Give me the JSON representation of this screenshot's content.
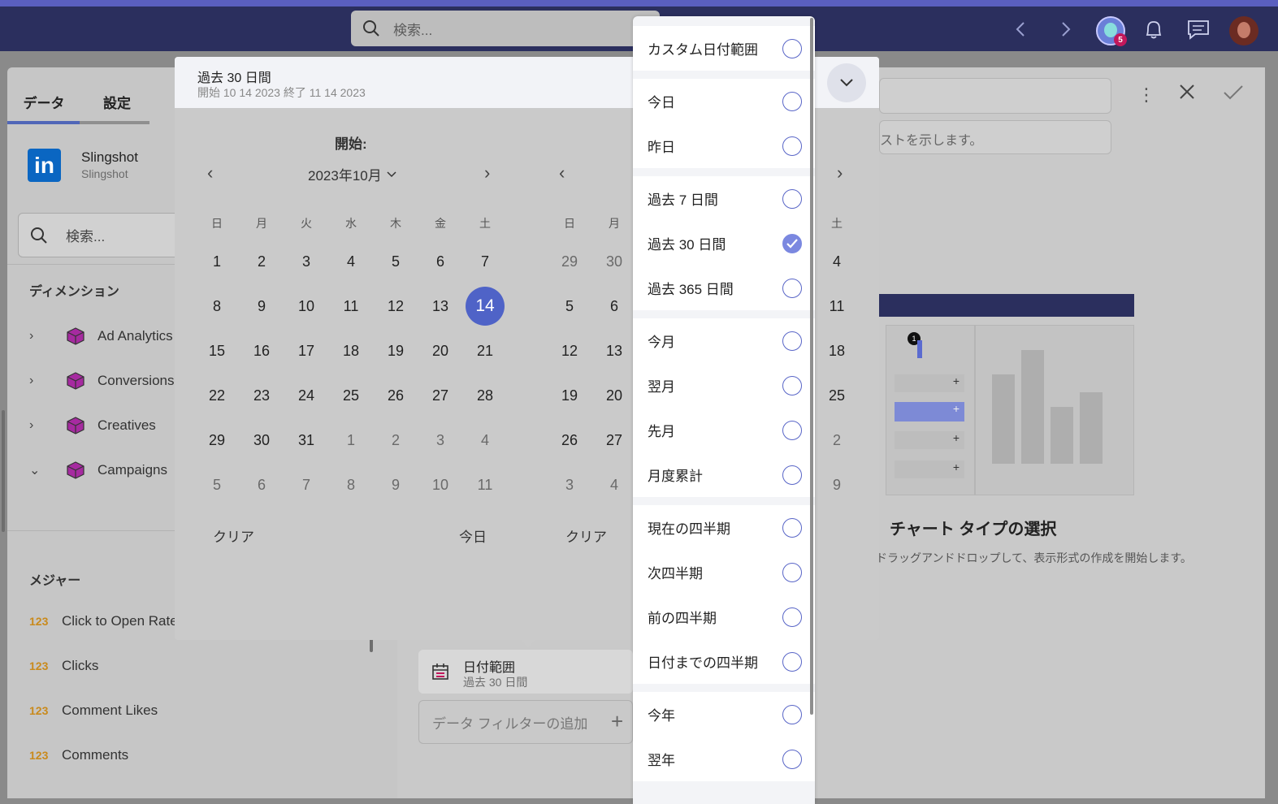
{
  "topbar": {
    "search_placeholder": "検索...",
    "notification_count": "5"
  },
  "left": {
    "tabs": [
      "データ",
      "設定"
    ],
    "datasource": {
      "name": "Slingshot",
      "sub": "Slingshot",
      "logo": "in"
    },
    "search_placeholder": "検索...",
    "dimensions_title": "ディメンション",
    "dimensions": [
      {
        "label": "Ad Analytics",
        "expanded": false
      },
      {
        "label": "Conversions",
        "expanded": false
      },
      {
        "label": "Creatives",
        "expanded": false
      },
      {
        "label": "Campaigns",
        "expanded": true
      }
    ],
    "measures_title": "メジャー",
    "measure_type": "123",
    "measures": [
      "Click to Open Rate",
      "Clicks",
      "Comment Likes",
      "Comments"
    ]
  },
  "right": {
    "hint_text": "ストを示します。",
    "chart_title": "チャート タイプの選択",
    "chart_sub": "ドラッグアンドドロップして、表示形式の作成を開始します。",
    "badge": "1"
  },
  "filter": {
    "title": "日付範囲",
    "sub": "過去 30 日間",
    "add_label": "データ フィルターの追加"
  },
  "picker": {
    "title": "過去 30 日間",
    "sub": "開始 10 14 2023 終了 11 14 2023",
    "start_label": "開始:",
    "month_label": "2023年10月",
    "weekdays": [
      "日",
      "月",
      "火",
      "水",
      "木",
      "金",
      "土"
    ],
    "clear_label": "クリア",
    "today_label": "今日",
    "selected_day": "14",
    "left_weeks": [
      [
        "1",
        "2",
        "3",
        "4",
        "5",
        "6",
        "7"
      ],
      [
        "8",
        "9",
        "10",
        "11",
        "12",
        "13",
        "14"
      ],
      [
        "15",
        "16",
        "17",
        "18",
        "19",
        "20",
        "21"
      ],
      [
        "22",
        "23",
        "24",
        "25",
        "26",
        "27",
        "28"
      ],
      [
        "29",
        "30",
        "31",
        "1",
        "2",
        "3",
        "4"
      ],
      [
        "5",
        "6",
        "7",
        "8",
        "9",
        "10",
        "11"
      ]
    ],
    "right_weeks_visible": [
      [
        "29",
        "30",
        "4"
      ],
      [
        "5",
        "6",
        "11"
      ],
      [
        "12",
        "13",
        "18"
      ],
      [
        "19",
        "20",
        "25"
      ],
      [
        "26",
        "27",
        "2"
      ],
      [
        "3",
        "4",
        "9"
      ]
    ]
  },
  "dropdown": {
    "groups": [
      [
        {
          "label": "カスタム日付範囲",
          "checked": false
        }
      ],
      [
        {
          "label": "今日",
          "checked": false
        },
        {
          "label": "昨日",
          "checked": false
        }
      ],
      [
        {
          "label": "過去 7 日間",
          "checked": false
        },
        {
          "label": "過去 30 日間",
          "checked": true
        },
        {
          "label": "過去 365 日間",
          "checked": false
        }
      ],
      [
        {
          "label": "今月",
          "checked": false
        },
        {
          "label": "翌月",
          "checked": false
        },
        {
          "label": "先月",
          "checked": false
        },
        {
          "label": "月度累計",
          "checked": false
        }
      ],
      [
        {
          "label": "現在の四半期",
          "checked": false
        },
        {
          "label": "次四半期",
          "checked": false
        },
        {
          "label": "前の四半期",
          "checked": false
        },
        {
          "label": "日付までの四半期",
          "checked": false
        }
      ],
      [
        {
          "label": "今年",
          "checked": false
        },
        {
          "label": "翌年",
          "checked": false
        }
      ]
    ]
  },
  "colors": {
    "accent": "#4f63c7",
    "topbar": "#2b2f5e",
    "linkedin": "#0a66c2",
    "measure_num": "#c98a1c"
  }
}
